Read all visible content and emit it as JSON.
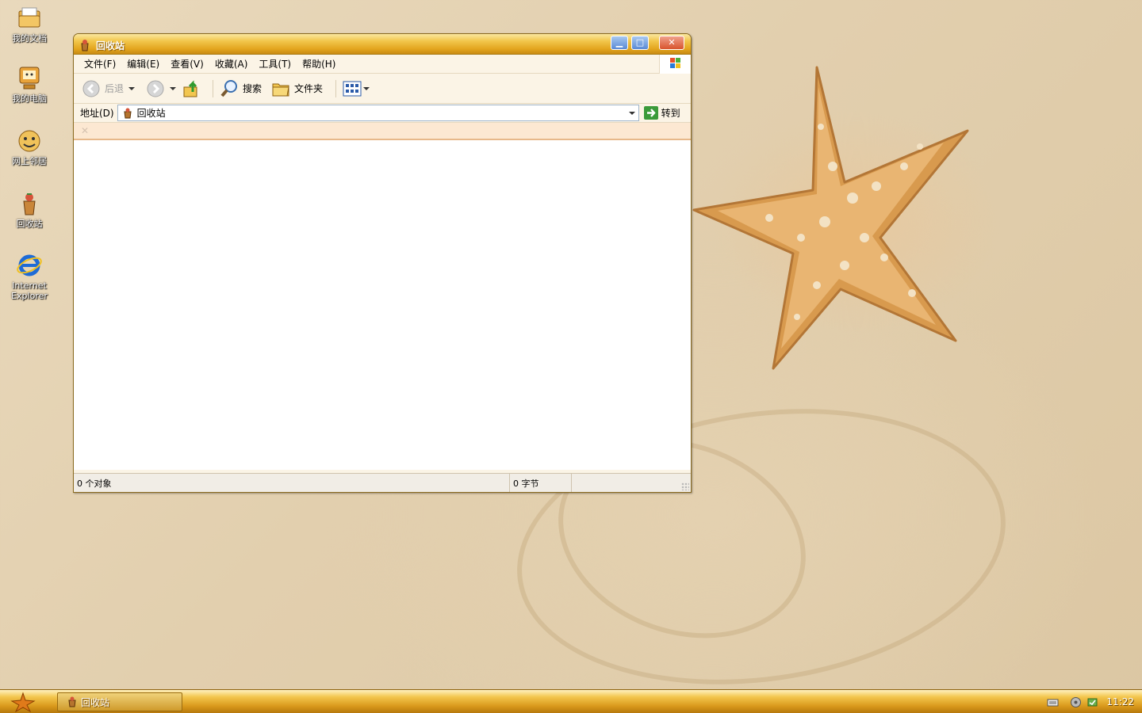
{
  "desktop": {
    "icons": [
      {
        "label": "我的文档"
      },
      {
        "label": "我的电脑"
      },
      {
        "label": "网上邻居"
      },
      {
        "label": "回收站"
      },
      {
        "label": "Internet Explorer"
      }
    ]
  },
  "window": {
    "title": "回收站",
    "buttons": {
      "minimize": "▁",
      "maximize": "□",
      "close": "✕"
    },
    "menu": [
      "文件(F)",
      "编辑(E)",
      "查看(V)",
      "收藏(A)",
      "工具(T)",
      "帮助(H)"
    ],
    "toolbar": {
      "back": "后退",
      "search": "搜索",
      "folders": "文件夹"
    },
    "address": {
      "label": "地址(D)",
      "value": "回收站",
      "go": "转到"
    },
    "status": {
      "objects": "0 个对象",
      "size": "0 字节"
    }
  },
  "taskbar": {
    "task": "回收站",
    "clock": "11:22"
  },
  "colors": {
    "title_gradient_top": "#fbe7a0",
    "title_gradient_bottom": "#c98b12",
    "window_bg": "#fbf4e6",
    "links_bar": "#fce8d2"
  }
}
